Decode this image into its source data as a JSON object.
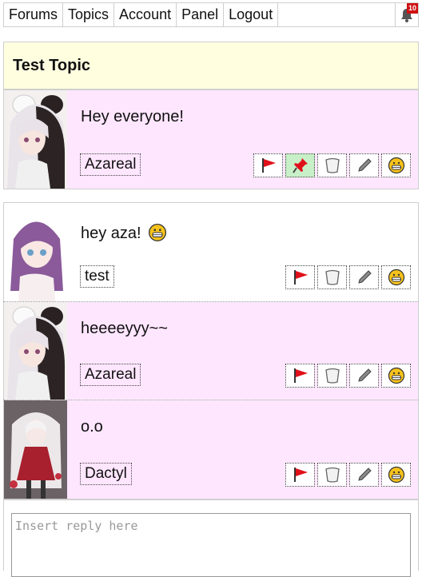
{
  "nav": {
    "items": [
      "Forums",
      "Topics",
      "Account",
      "Panel",
      "Logout"
    ],
    "notifications_count": "10"
  },
  "topic": {
    "title": "Test Topic"
  },
  "posts": [
    {
      "content": "Hey everyone!",
      "user": "Azareal",
      "pinned_action": true
    },
    {
      "content": "hey aza!",
      "user": "test",
      "emoji": "grin"
    },
    {
      "content": "heeeeyyy~~",
      "user": "Azareal"
    },
    {
      "content": "o.o",
      "user": "Dactyl"
    }
  ],
  "reply": {
    "placeholder": "Insert reply here"
  },
  "colors": {
    "post_pink": "#ffe6ff",
    "topic_header": "#ffffe0",
    "pin_active": "#c8f0c8",
    "badge": "#d01010"
  }
}
